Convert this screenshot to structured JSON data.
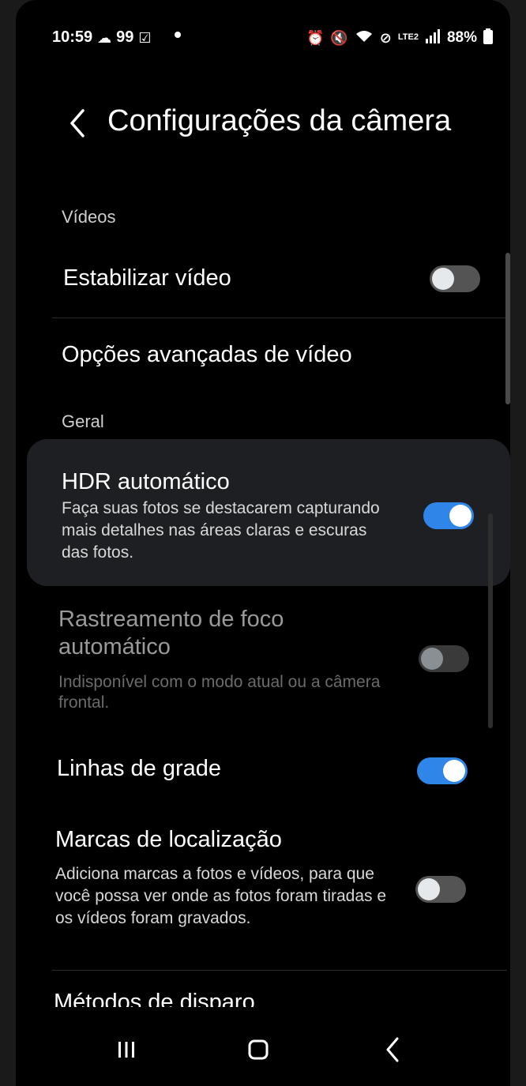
{
  "status_bar": {
    "time": "10:59",
    "notification_count": "99",
    "battery": "88%",
    "network": "LTE2"
  },
  "header": {
    "title": "Configurações da câmera"
  },
  "sections": {
    "videos": "Vídeos",
    "geral": "Geral"
  },
  "settings": {
    "estabilizar": {
      "label": "Estabilizar vídeo",
      "state": "off"
    },
    "opcoes_video": {
      "label": "Opções avançadas de vídeo"
    },
    "hdr": {
      "label": "HDR automático",
      "description": "Faça suas fotos se destacarem capturando mais detalhes nas áreas claras e escuras das fotos.",
      "state": "on"
    },
    "rastreamento": {
      "label": "Rastreamento de foco automático",
      "description": "Indisponível com o modo atual ou a câmera frontal.",
      "state": "disabled"
    },
    "linhas_grade": {
      "label": "Linhas de grade",
      "state": "on"
    },
    "marcas_localizacao": {
      "label": "Marcas de localização",
      "description": "Adiciona marcas a fotos e vídeos, para que você possa ver onde as fotos foram tiradas e os vídeos foram gravados.",
      "state": "off"
    },
    "metodos_disparo": {
      "label": "Métodos de disparo"
    }
  },
  "colors": {
    "accent": "#2f86e8",
    "background": "#000000",
    "text": "#ffffff"
  },
  "icons": {
    "back": "chevron-left-icon",
    "recents": "recents-icon",
    "home": "home-icon",
    "nav_back": "back-icon"
  }
}
